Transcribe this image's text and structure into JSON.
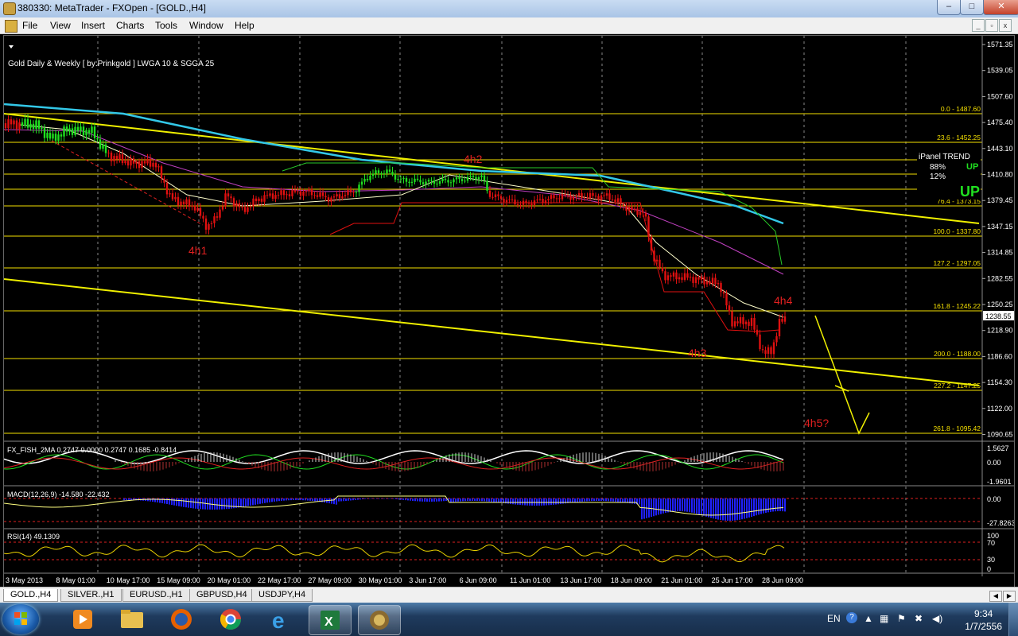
{
  "window": {
    "title": "380330: MetaTrader - FXOpen - [GOLD.,H4]",
    "min_label": "–",
    "max_label": "□",
    "close_label": "✕"
  },
  "menu": {
    "items": [
      "File",
      "View",
      "Insert",
      "Charts",
      "Tools",
      "Window",
      "Help"
    ],
    "mdi_min": "_",
    "mdi_restore": "▫",
    "mdi_close": "x"
  },
  "chart": {
    "header": "Gold Daily & Weekly [ by:Prinkgold ] LWGA 10  &  SGGA 25",
    "price_labels": [
      "1571.35",
      "1539.05",
      "1507.60",
      "1475.40",
      "1443.10",
      "1410.80",
      "1379.45",
      "1347.15",
      "1314.85",
      "1282.55",
      "1250.25",
      "1218.90",
      "1186.60",
      "1154.30",
      "1122.00",
      "1090.65"
    ],
    "current_price": "1238.55",
    "fib_levels": [
      {
        "label": "0.0 - 1487.60"
      },
      {
        "label": "23.6 - 1452.25"
      },
      {
        "label": "38.2 - 1430.5"
      },
      {
        "label": "50.0 - 1412.70"
      },
      {
        "label": "61.8 - 1395.2"
      },
      {
        "label": "76.4 - 1373.15"
      },
      {
        "label": "100.0 - 1337.80"
      },
      {
        "label": "127.2 - 1297.05"
      },
      {
        "label": "161.8 - 1245.22"
      },
      {
        "label": "200.0 - 1188.00"
      },
      {
        "label": "227.2 - 1147.25"
      },
      {
        "label": "261.8 - 1095.42"
      }
    ],
    "annotations": [
      "4h1",
      "4h2",
      "4h3",
      "4h4",
      "4h5?"
    ],
    "ipanel": {
      "title": "iPanel TREND",
      "line1": "88%",
      "line2": "12%",
      "up1": "UP",
      "up2": "UP"
    },
    "time_labels": [
      "3 May 2013",
      "8 May 01:00",
      "10 May 17:00",
      "15 May 09:00",
      "20 May 01:00",
      "22 May 17:00",
      "27 May 09:00",
      "30 May 01:00",
      "3 Jun 17:00",
      "6 Jun 09:00",
      "11 Jun 01:00",
      "13 Jun 17:00",
      "18 Jun 09:00",
      "21 Jun 01:00",
      "25 Jun 17:00",
      "28 Jun 09:00"
    ],
    "fisher": {
      "label": "FX_FISH_2MA 0.2747 0.0000 0.2747 0.1685 -0.8414",
      "ticks": [
        "1.5627",
        "0.00",
        "-1.9601"
      ]
    },
    "macd": {
      "label": "MACD(12,26,9) -14.580 -22.432",
      "ticks": [
        "0.00",
        "-27.8263"
      ]
    },
    "rsi": {
      "label": "RSI(14) 49.1309",
      "ticks": [
        "100",
        "70",
        "30",
        "0"
      ]
    }
  },
  "tabs": [
    {
      "label": "GOLD.,H4"
    },
    {
      "label": "SILVER.,H1"
    },
    {
      "label": "EURUSD.,H1"
    },
    {
      "label": "GBPUSD,H4"
    },
    {
      "label": "USDJPY,H4"
    }
  ],
  "taskbar": {
    "lang": "EN",
    "time": "9:34",
    "date": "1/7/2556"
  },
  "colors": {
    "fib_line": "#f5e000",
    "bear_candle": "#e01010",
    "bull_candle": "#20e020",
    "trend_line": "#ffff00",
    "cyan_ma": "#33c8e8",
    "magenta_ma": "#c040c0",
    "macd_hist": "#2020ff",
    "annotation": "#e02020"
  }
}
